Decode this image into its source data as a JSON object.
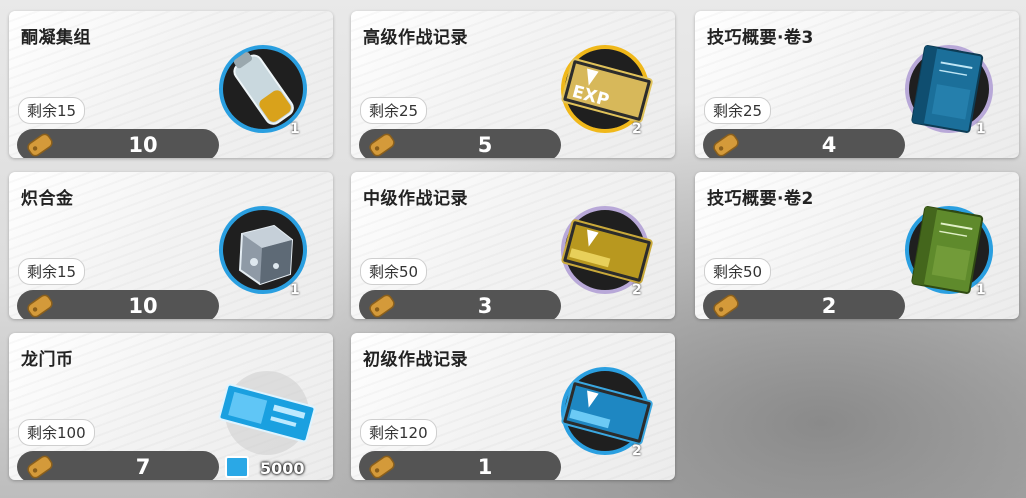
{
  "colors": {
    "ring_blue": "#2a9fe0",
    "ring_gold": "#f0b81a",
    "ring_purple": "#b8a8d8",
    "price_bar": "#545454"
  },
  "items": [
    {
      "name": "酮凝集组",
      "stock": "剩余15",
      "price": "10",
      "qty": "1",
      "icon": "ketone-bottle-icon",
      "ring": "blue"
    },
    {
      "name": "高级作战记录",
      "stock": "剩余25",
      "price": "5",
      "qty": "2",
      "icon": "advanced-battle-record-icon",
      "ring": "gold",
      "icon_text": "EXP"
    },
    {
      "name": "技巧概要·卷3",
      "stock": "剩余25",
      "price": "4",
      "qty": "1",
      "icon": "skill-summary-3-icon",
      "ring": "purple"
    },
    {
      "name": "炽合金",
      "stock": "剩余15",
      "price": "10",
      "qty": "1",
      "icon": "incandescent-alloy-icon",
      "ring": "blue"
    },
    {
      "name": "中级作战记录",
      "stock": "剩余50",
      "price": "3",
      "qty": "2",
      "icon": "intermediate-battle-record-icon",
      "ring": "purple"
    },
    {
      "name": "技巧概要·卷2",
      "stock": "剩余50",
      "price": "2",
      "qty": "1",
      "icon": "skill-summary-2-icon",
      "ring": "blue"
    },
    {
      "name": "龙门币",
      "stock": "剩余100",
      "price": "7",
      "qty": "5000",
      "icon": "lmd-icon",
      "ring": "none"
    },
    {
      "name": "初级作战记录",
      "stock": "剩余120",
      "price": "1",
      "qty": "2",
      "icon": "basic-battle-record-icon",
      "ring": "blue"
    }
  ]
}
